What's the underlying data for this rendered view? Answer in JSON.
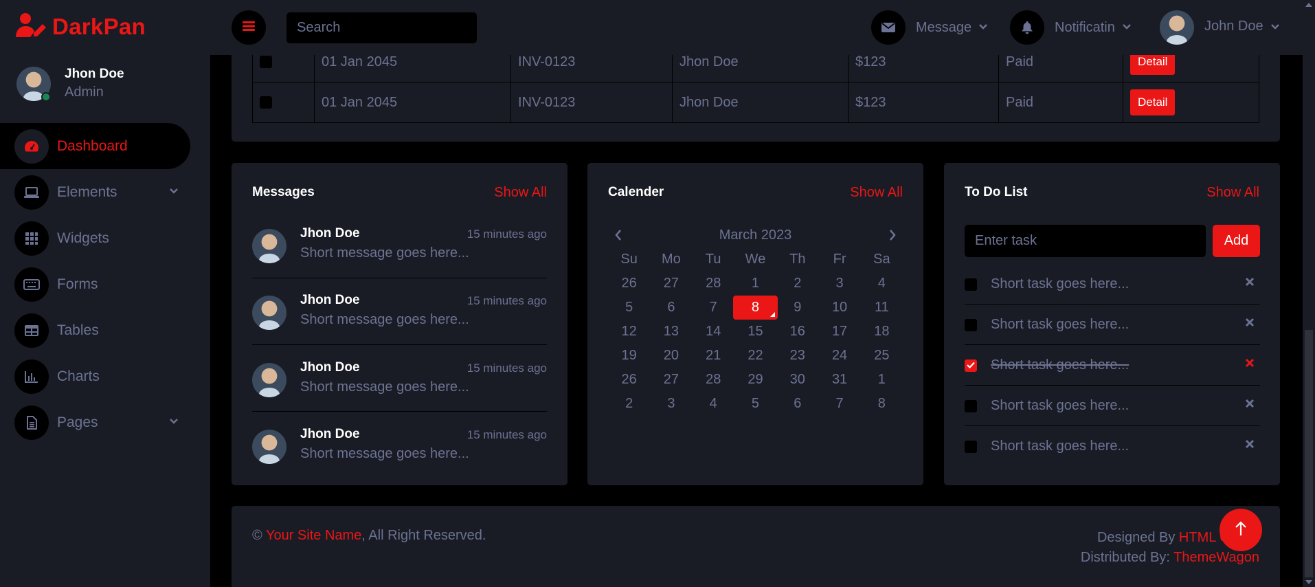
{
  "colors": {
    "accent": "#eb1616",
    "panel": "#191c24",
    "bg": "#000000",
    "text": "#6c7293",
    "white": "#ffffff"
  },
  "brand": {
    "name": "DarkPan",
    "icon": "user-edit-icon"
  },
  "profile": {
    "name": "Jhon Doe",
    "role": "Admin",
    "status": "online"
  },
  "sidebar": {
    "items": [
      {
        "label": "Dashboard",
        "icon": "tachometer-icon",
        "active": true
      },
      {
        "label": "Elements",
        "icon": "laptop-icon",
        "dropdown": true
      },
      {
        "label": "Widgets",
        "icon": "grid-icon"
      },
      {
        "label": "Forms",
        "icon": "keyboard-icon"
      },
      {
        "label": "Tables",
        "icon": "table-icon"
      },
      {
        "label": "Charts",
        "icon": "chart-bar-icon"
      },
      {
        "label": "Pages",
        "icon": "file-icon",
        "dropdown": true
      }
    ]
  },
  "topbar": {
    "search_placeholder": "Search",
    "message_label": "Message",
    "notification_label": "Notificatin",
    "user_name": "John Doe"
  },
  "invoices": {
    "rows": [
      {
        "date": "01 Jan 2045",
        "invoice": "INV-0123",
        "customer": "Jhon Doe",
        "amount": "$123",
        "status": "Paid",
        "action": "Detail"
      },
      {
        "date": "01 Jan 2045",
        "invoice": "INV-0123",
        "customer": "Jhon Doe",
        "amount": "$123",
        "status": "Paid",
        "action": "Detail"
      }
    ]
  },
  "messages": {
    "title": "Messages",
    "show_all": "Show All",
    "items": [
      {
        "name": "Jhon Doe",
        "time": "15 minutes ago",
        "text": "Short message goes here..."
      },
      {
        "name": "Jhon Doe",
        "time": "15 minutes ago",
        "text": "Short message goes here..."
      },
      {
        "name": "Jhon Doe",
        "time": "15 minutes ago",
        "text": "Short message goes here..."
      },
      {
        "name": "Jhon Doe",
        "time": "15 minutes ago",
        "text": "Short message goes here..."
      }
    ]
  },
  "calendar": {
    "title": "Calender",
    "show_all": "Show All",
    "month": "March 2023",
    "weekdays": [
      "Su",
      "Mo",
      "Tu",
      "We",
      "Th",
      "Fr",
      "Sa"
    ],
    "days": [
      "26",
      "27",
      "28",
      "1",
      "2",
      "3",
      "4",
      "5",
      "6",
      "7",
      "8",
      "9",
      "10",
      "11",
      "12",
      "13",
      "14",
      "15",
      "16",
      "17",
      "18",
      "19",
      "20",
      "21",
      "22",
      "23",
      "24",
      "25",
      "26",
      "27",
      "28",
      "29",
      "30",
      "31",
      "1",
      "2",
      "3",
      "4",
      "5",
      "6",
      "7",
      "8"
    ],
    "selected": "8"
  },
  "todo": {
    "title": "To Do List",
    "show_all": "Show All",
    "input_placeholder": "Enter task",
    "add_label": "Add",
    "tasks": [
      {
        "text": "Short task goes here...",
        "done": false
      },
      {
        "text": "Short task goes here...",
        "done": false
      },
      {
        "text": "Short task goes here...",
        "done": true
      },
      {
        "text": "Short task goes here...",
        "done": false
      },
      {
        "text": "Short task goes here...",
        "done": false
      }
    ]
  },
  "footer": {
    "copyright_symbol": "©",
    "site_name": "Your Site Name",
    "rights": ", All Right Reserved.",
    "designed_by": "Designed By ",
    "designer": "HTML Codex",
    "distributed_by": "Distributed By: ",
    "distributor": "ThemeWagon"
  }
}
